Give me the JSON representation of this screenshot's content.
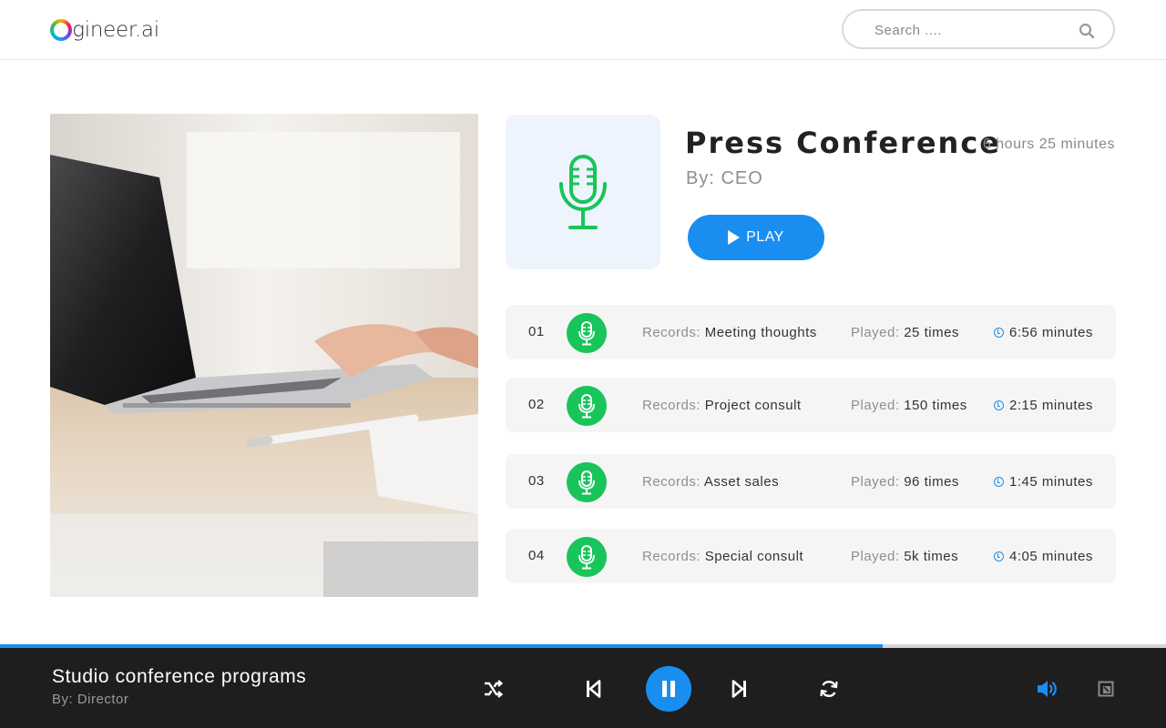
{
  "header": {
    "logo_text": "ngineer.ai",
    "search_placeholder": "Search ...."
  },
  "album": {
    "title": "Press Conference",
    "duration": "6 hours 25 minutes",
    "byline": "By: CEO",
    "play_label": "PLAY"
  },
  "labels": {
    "records": "Records:",
    "played": "Played:"
  },
  "tracks": [
    {
      "num": "01",
      "record": "Meeting thoughts",
      "played": "25 times",
      "time": "6:56 minutes"
    },
    {
      "num": "02",
      "record": "Project consult",
      "played": "150 times",
      "time": "2:15 minutes"
    },
    {
      "num": "03",
      "record": "Asset sales",
      "played": "96 times",
      "time": "1:45 minutes"
    },
    {
      "num": "04",
      "record": "Special consult",
      "played": "5k times",
      "time": "4:05 minutes"
    }
  ],
  "player": {
    "title": "Studio conference programs",
    "byline": "By: Director",
    "progress_percent": 75.7
  },
  "colors": {
    "accent": "#1a8ef0",
    "mic_green": "#19c45a",
    "player_bg": "#1e1e1e"
  },
  "icons": [
    "search-icon",
    "microphone-icon",
    "play-icon",
    "clock-icon",
    "shuffle-icon",
    "previous-icon",
    "pause-icon",
    "next-icon",
    "repeat-icon",
    "volume-icon",
    "expand-icon"
  ]
}
